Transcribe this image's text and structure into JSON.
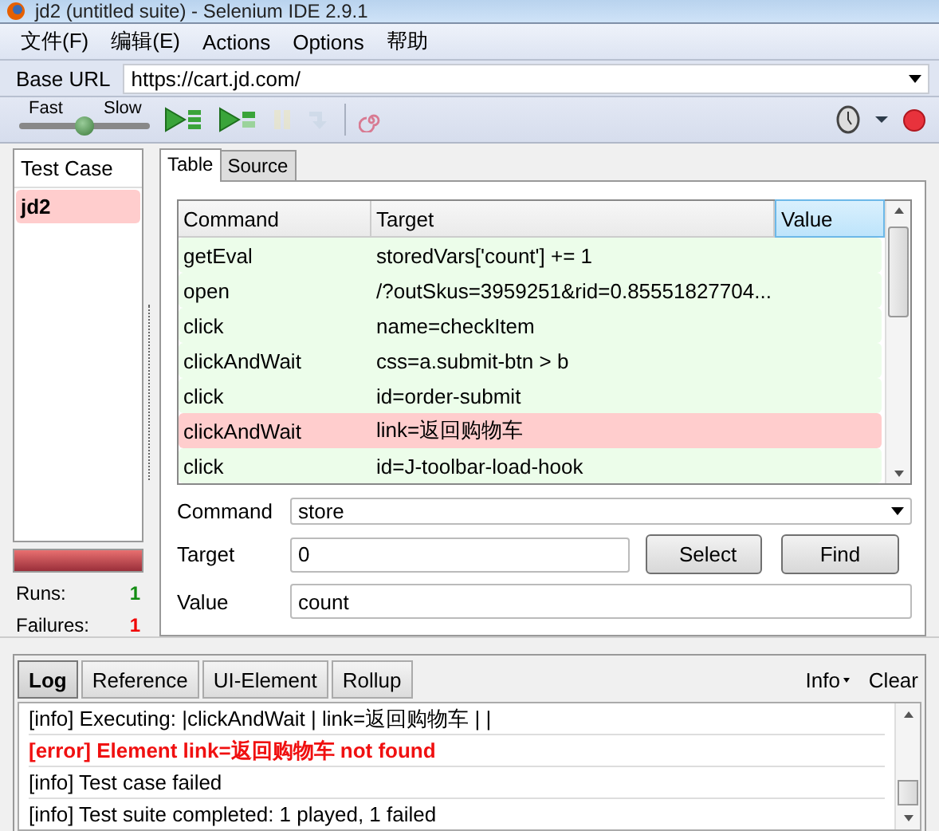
{
  "window": {
    "title": "jd2 (untitled suite) - Selenium IDE 2.9.1"
  },
  "menu": [
    "文件(F)",
    "编辑(E)",
    "Actions",
    "Options",
    "帮助"
  ],
  "base_url": {
    "label": "Base URL",
    "value": "https://cart.jd.com/"
  },
  "toolbar": {
    "speed": {
      "fast_label": "Fast",
      "slow_label": "Slow",
      "level": 0.5
    },
    "buttons": [
      {
        "kind": "play-suite",
        "disabled": false
      },
      {
        "kind": "play-case",
        "disabled": false
      },
      {
        "kind": "pause",
        "disabled": true
      },
      {
        "kind": "step",
        "disabled": true
      },
      {
        "kind": "rollup",
        "disabled": false
      },
      {
        "kind": "timer",
        "disabled": false
      },
      {
        "kind": "dropdown",
        "disabled": false
      },
      {
        "kind": "record",
        "disabled": false
      }
    ]
  },
  "test_cases": {
    "header": "Test Case",
    "items": [
      {
        "name": "jd2",
        "failed": true
      }
    ],
    "progress": {
      "level": 1,
      "failed": true
    },
    "stats": [
      {
        "label": "Runs:",
        "value": "1",
        "kind": "runs"
      },
      {
        "label": "Failures:",
        "value": "1",
        "kind": "failures"
      }
    ]
  },
  "editor": {
    "tabs": [
      {
        "label": "Table",
        "selected": true
      },
      {
        "label": "Source",
        "selected": false
      }
    ],
    "table": {
      "columns": [
        {
          "label": "Command",
          "selected": false
        },
        {
          "label": "Target",
          "selected": false
        },
        {
          "label": "Value",
          "selected": true
        }
      ],
      "rows": [
        {
          "command": "getEval",
          "target": "storedVars['count'] += 1",
          "failed": false
        },
        {
          "command": "open",
          "target": "/?outSkus=3959251&rid=0.85551827704...",
          "failed": false
        },
        {
          "command": "click",
          "target": "name=checkItem",
          "failed": false
        },
        {
          "command": "clickAndWait",
          "target": "css=a.submit-btn > b",
          "failed": false
        },
        {
          "command": "click",
          "target": "id=order-submit",
          "failed": false
        },
        {
          "command": "clickAndWait",
          "target": "link=返回购物车",
          "failed": true
        },
        {
          "command": "click",
          "target": "id=J-toolbar-load-hook",
          "failed": false
        }
      ]
    },
    "fields": {
      "command": {
        "label": "Command",
        "value": "store"
      },
      "target": {
        "label": "Target",
        "value": "0"
      },
      "value": {
        "label": "Value",
        "value": "count"
      },
      "buttons": [
        "Select",
        "Find"
      ]
    }
  },
  "log": {
    "tabs": [
      {
        "label": "Log",
        "selected": true
      },
      {
        "label": "Reference",
        "selected": false
      },
      {
        "label": "UI-Element",
        "selected": false
      },
      {
        "label": "Rollup",
        "selected": false
      }
    ],
    "filter": "Info",
    "clear": "Clear",
    "lines": [
      {
        "kind": "info",
        "text": "[info] Executing: |clickAndWait | link=返回购物车 | |"
      },
      {
        "kind": "error",
        "text": "[error] Element link=返回购物车 not found"
      },
      {
        "kind": "info",
        "text": "[info] Test case failed"
      },
      {
        "kind": "info",
        "text": "[info] Test suite completed: 1 played, 1 failed"
      }
    ]
  }
}
